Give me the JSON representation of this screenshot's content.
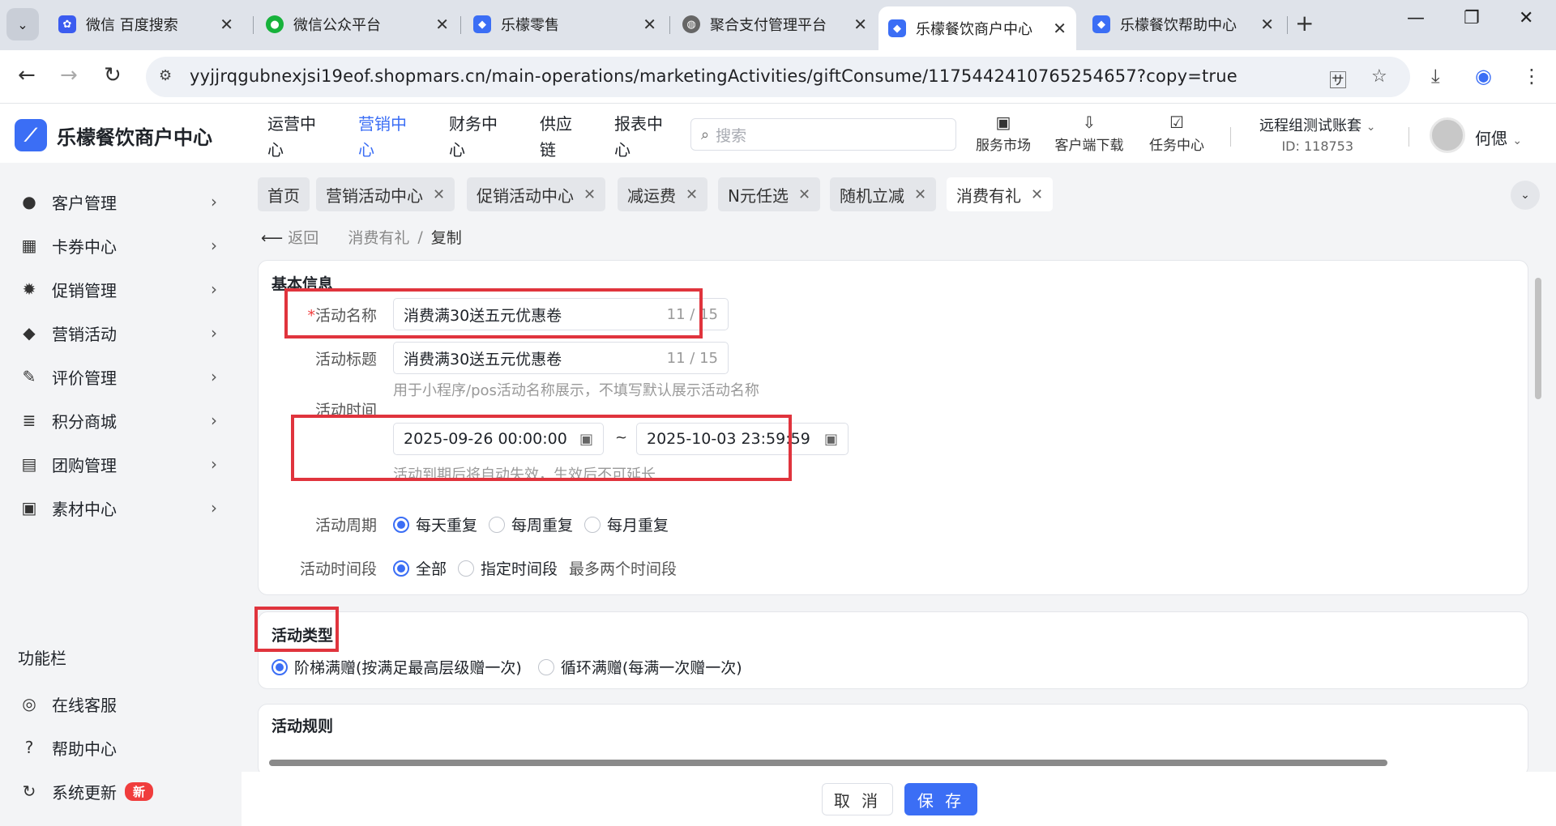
{
  "browser": {
    "tabs": [
      {
        "title": "微信 百度搜索",
        "icon_color": "#3b5cf0",
        "icon": "paw-icon"
      },
      {
        "title": "微信公众平台",
        "icon_color": "#17b23b",
        "icon": "wechat-icon"
      },
      {
        "title": "乐檬零售",
        "icon_color": "#3b6ef5",
        "icon": "lemon-logo-icon"
      },
      {
        "title": "聚合支付管理平台",
        "icon_color": "#666666",
        "icon": "globe-icon"
      },
      {
        "title": "乐檬餐饮商户中心",
        "icon_color": "#3b6ef5",
        "icon": "lemon-logo-icon",
        "active": true
      },
      {
        "title": "乐檬餐饮帮助中心",
        "icon_color": "#3b6ef5",
        "icon": "lemon-logo-icon"
      }
    ],
    "url": "yyjjrqgubnexjsi19eof.shopmars.cn/main-operations/marketingActivities/giftConsume/1175442410765254657?copy=true"
  },
  "header": {
    "logo_text": "乐檬餐饮商户中心",
    "nav": [
      {
        "label": "运营中心",
        "active": false
      },
      {
        "label": "营销中心",
        "active": true
      },
      {
        "label": "财务中心",
        "active": false
      },
      {
        "label": "供应链",
        "active": false
      },
      {
        "label": "报表中心",
        "active": false
      }
    ],
    "search_placeholder": "搜索",
    "tools": [
      "服务市场",
      "客户端下载",
      "任务中心"
    ],
    "account_name": "远程组测试账套",
    "account_id": "ID: 118753",
    "user_name": "何偲"
  },
  "sidebar": {
    "items": [
      {
        "label": "客户管理",
        "icon": "user-icon"
      },
      {
        "label": "卡券中心",
        "icon": "ticket-icon"
      },
      {
        "label": "促销管理",
        "icon": "discount-icon"
      },
      {
        "label": "营销活动",
        "icon": "tag-icon"
      },
      {
        "label": "评价管理",
        "icon": "edit-icon"
      },
      {
        "label": "积分商城",
        "icon": "coins-icon"
      },
      {
        "label": "团购管理",
        "icon": "group-icon"
      },
      {
        "label": "素材中心",
        "icon": "image-icon"
      }
    ],
    "group_label": "功能栏",
    "footer_items": [
      {
        "label": "在线客服",
        "icon": "headset-icon"
      },
      {
        "label": "帮助中心",
        "icon": "help-icon"
      },
      {
        "label": "系统更新",
        "icon": "refresh-icon",
        "badge": "新"
      }
    ]
  },
  "page_tabs": [
    {
      "label": "首页",
      "closable": false
    },
    {
      "label": "营销活动中心",
      "closable": true
    },
    {
      "label": "促销活动中心",
      "closable": true
    },
    {
      "label": "减运费",
      "closable": true
    },
    {
      "label": "N元任选",
      "closable": true
    },
    {
      "label": "随机立减",
      "closable": true
    },
    {
      "label": "消费有礼",
      "closable": true,
      "active": true
    }
  ],
  "breadcrumb": {
    "back": "返回",
    "parent": "消费有礼",
    "separator": "/",
    "current": "复制"
  },
  "basic_info": {
    "title": "基本信息",
    "name_label": "活动名称",
    "name_value": "消费满30送五元优惠卷",
    "name_count": "11 / 15",
    "title_label": "活动标题",
    "title_value": "消费满30送五元优惠卷",
    "title_count": "11 / 15",
    "title_hint": "用于小程序/pos活动名称展示，不填写默认展示活动名称",
    "time_label": "活动时间",
    "start_time": "2025-09-26 00:00:00",
    "time_sep": "~",
    "end_time": "2025-10-03 23:59:59",
    "time_hint": "活动到期后将自动失效，生效后不可延长",
    "cycle_label": "活动周期",
    "cycle_options": [
      "每天重复",
      "每周重复",
      "每月重复"
    ],
    "cycle_selected": 0,
    "period_label": "活动时间段",
    "period_options": [
      "全部",
      "指定时间段"
    ],
    "period_selected": 0,
    "period_note": "最多两个时间段"
  },
  "activity_type": {
    "title": "活动类型",
    "options": [
      "阶梯满赠(按满足最高层级赠一次)",
      "循环满赠(每满一次赠一次)"
    ],
    "selected": 0
  },
  "activity_rules": {
    "title": "活动规则"
  },
  "footer": {
    "cancel": "取 消",
    "save": "保 存"
  },
  "colors": {
    "accent": "#3b6ef5",
    "highlight_box": "#e0343d",
    "badge": "#f03d3d"
  }
}
